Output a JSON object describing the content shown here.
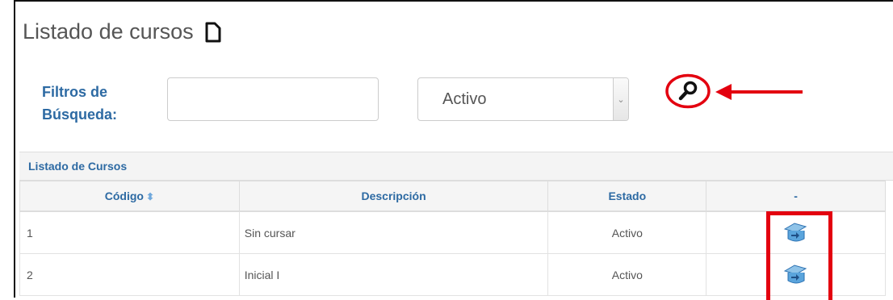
{
  "page": {
    "title": "Listado de cursos",
    "title_icon": "document-icon"
  },
  "filters": {
    "label_line1": "Filtros de",
    "label_line2": "Búsqueda:",
    "text_value": "",
    "status_select": {
      "selected": "Activo"
    },
    "search_icon": "magnifier-icon"
  },
  "panel": {
    "title": "Listado de Cursos",
    "columns": [
      "Código",
      "Descripción",
      "Estado",
      "-"
    ],
    "rows": [
      {
        "code": "1",
        "description": "Sin cursar",
        "status": "Activo"
      },
      {
        "code": "2",
        "description": "Inicial I",
        "status": "Activo"
      }
    ],
    "row_action_icon": "edit-course-icon"
  },
  "annotation_color": "#e3000f",
  "accent_color": "#2d6aa3"
}
